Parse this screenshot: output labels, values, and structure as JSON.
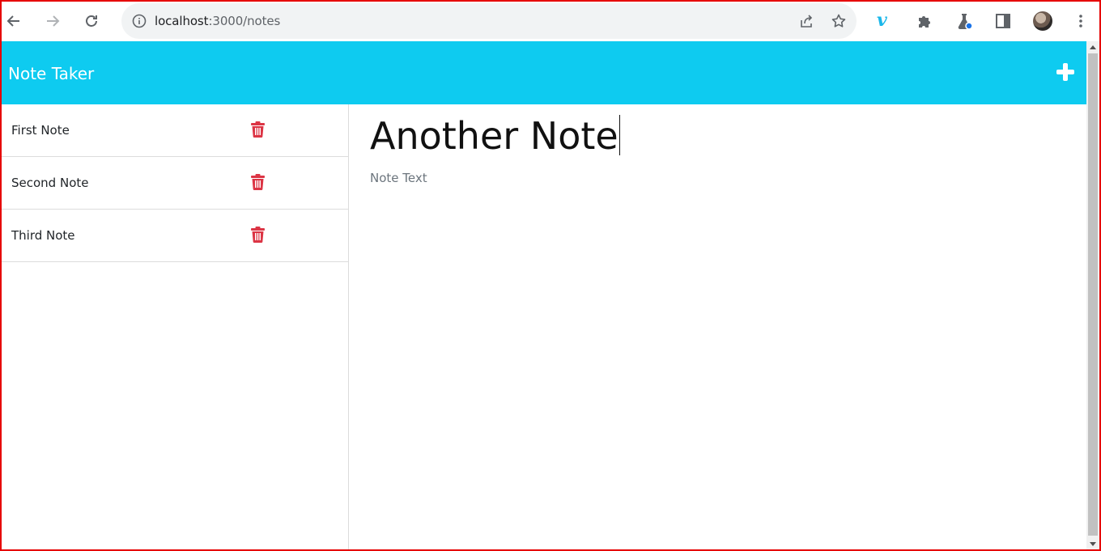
{
  "browser": {
    "url_host": "localhost",
    "url_rest": ":3000/notes",
    "extension_icon": "vimeo-icon",
    "extension_label": "v"
  },
  "app": {
    "brand": "Note Taker",
    "new_note_icon": "plus-icon",
    "accent_color": "#0ecbf0",
    "delete_color": "#dc3545"
  },
  "notes": [
    {
      "title": "First Note"
    },
    {
      "title": "Second Note"
    },
    {
      "title": "Third Note"
    }
  ],
  "editor": {
    "title_value": "Another Note",
    "text_placeholder": "Note Text"
  }
}
